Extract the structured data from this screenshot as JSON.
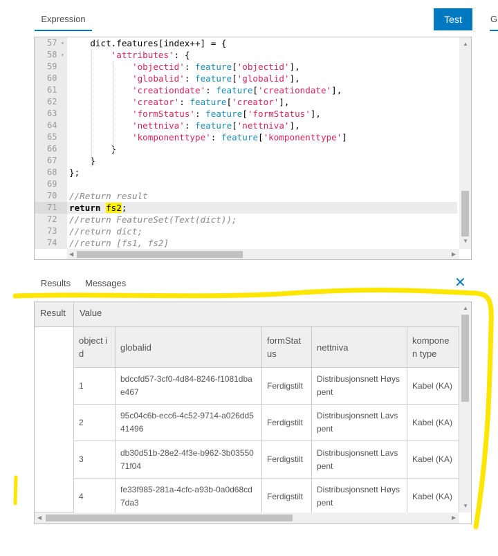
{
  "header": {
    "expression_tab": "Expression",
    "test_button": "Test",
    "next_tab": "G"
  },
  "editor": {
    "lines": [
      {
        "n": "57",
        "fold": true,
        "html": "    dict.features[index++] = {"
      },
      {
        "n": "58",
        "fold": true,
        "html": "        <span class='s'>'attributes'</span>: {"
      },
      {
        "n": "59",
        "html": "            <span class='s'>'objectid'</span>: <span class='f'>feature</span>[<span class='s'>'objectid'</span>],"
      },
      {
        "n": "60",
        "html": "            <span class='s'>'globalid'</span>: <span class='f'>feature</span>[<span class='s'>'globalid'</span>],"
      },
      {
        "n": "61",
        "html": "            <span class='s'>'creationdate'</span>: <span class='f'>feature</span>[<span class='s'>'creationdate'</span>],"
      },
      {
        "n": "62",
        "html": "            <span class='s'>'creator'</span>: <span class='f'>feature</span>[<span class='s'>'creator'</span>],"
      },
      {
        "n": "63",
        "html": "            <span class='s'>'formStatus'</span>: <span class='f'>feature</span>[<span class='s'>'formStatus'</span>],"
      },
      {
        "n": "64",
        "html": "            <span class='s'>'nettniva'</span>: <span class='f'>feature</span>[<span class='s'>'nettniva'</span>],"
      },
      {
        "n": "65",
        "html": "            <span class='s'>'komponenttype'</span>: <span class='f'>feature</span>[<span class='s'>'komponenttype'</span>]"
      },
      {
        "n": "66",
        "html": "        }"
      },
      {
        "n": "67",
        "html": "    }"
      },
      {
        "n": "68",
        "html": "};"
      },
      {
        "n": "69",
        "html": ""
      },
      {
        "n": "70",
        "html": "<span class='c'>//Return result</span>"
      },
      {
        "n": "71",
        "active": true,
        "html": "<span class='k'>return</span> <span class='hl'>fs2</span>;"
      },
      {
        "n": "72",
        "html": "<span class='c'>//return FeatureSet(Text(dict));</span>"
      },
      {
        "n": "73",
        "html": "<span class='c'>//return dict;</span>"
      },
      {
        "n": "74",
        "html": "<span class='c'>//return [fs1, fs2]</span>"
      }
    ]
  },
  "results": {
    "tabs": [
      "Results",
      "Messages"
    ],
    "close": "✕",
    "headers": {
      "result": "Result",
      "value": "Value"
    },
    "columns": [
      "object id",
      "globalid",
      "formStat us",
      "nettniva",
      "komponen type"
    ],
    "rows": [
      [
        "1",
        "bdccfd57-3cf0-4d84-8246-f1081dbae467",
        "Ferdigstilt",
        "Distribusjonsnett Høyspent",
        "Kabel (KA)"
      ],
      [
        "2",
        "95c04c6b-ecc6-4c52-9714-a026dd541496",
        "Ferdigstilt",
        "Distribusjonsnett Lavspent",
        "Kabel (KA)"
      ],
      [
        "3",
        "db30d51b-28e2-4f3e-b962-3b0355071f04",
        "Ferdigstilt",
        "Distribusjonsnett Lavspent",
        "Kabel (KA)"
      ],
      [
        "4",
        "fe33f985-281a-4cfc-a93b-0a0d68cd7da3",
        "Ferdigstilt",
        "Distribusjonsnett Høyspent",
        "Kabel (KA)"
      ]
    ]
  },
  "colors": {
    "accent": "#0079c1",
    "results_tab": "#35ac46",
    "annotation": "#ffe600"
  }
}
